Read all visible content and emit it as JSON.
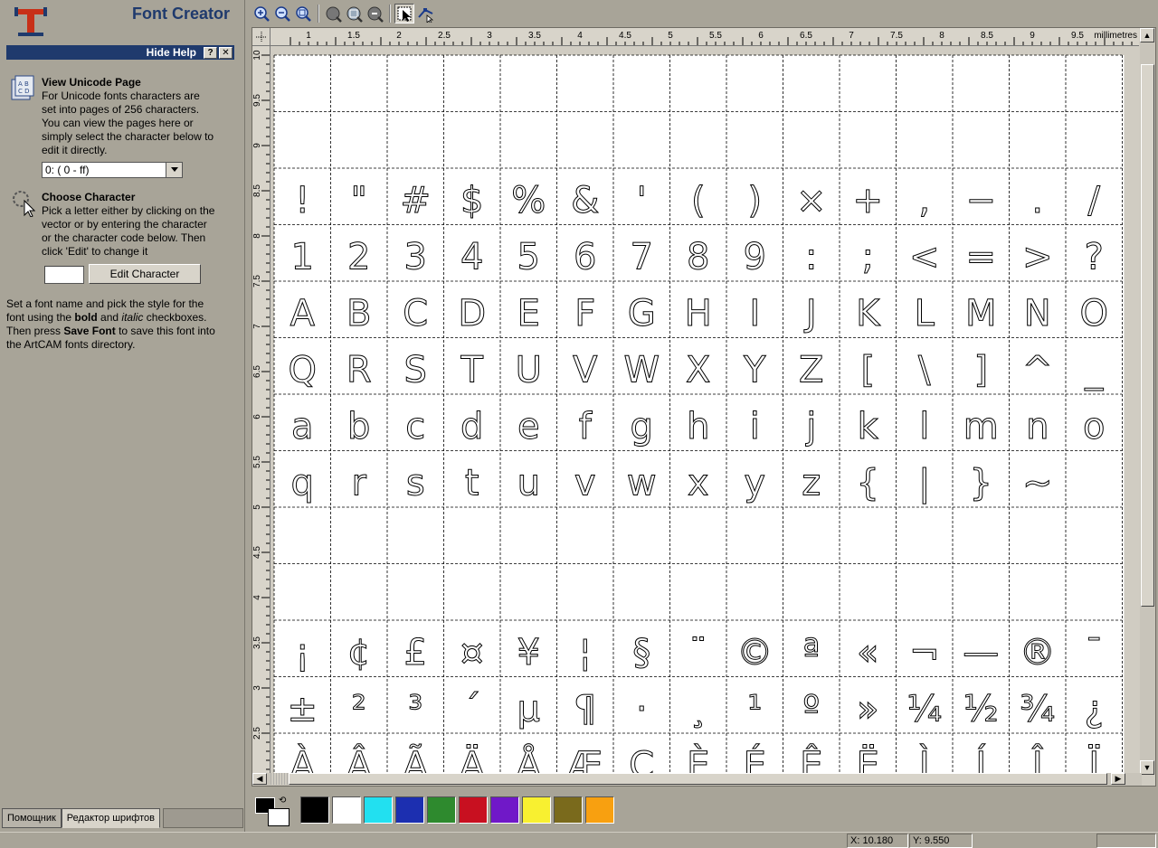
{
  "app": {
    "title": "Font Creator"
  },
  "help_bar": {
    "label": "Hide Help",
    "help_btn": "?",
    "close_btn": "✕"
  },
  "unicode_section": {
    "title": "View Unicode Page",
    "lines": [
      "For Unicode fonts characters are",
      "set into pages of 256 characters.",
      "You can view the pages here or",
      "simply select the character below to",
      "edit it directly."
    ],
    "selected_page": "0: ( 0 - ff)"
  },
  "choose_section": {
    "title": "Choose Character",
    "lines": [
      "Pick a letter either by clicking on the",
      "vector or by entering the character",
      "or the character code below. Then",
      "click 'Edit' to change it"
    ],
    "char_value": "",
    "edit_btn": "Edit Character"
  },
  "font_help": {
    "l1": "Set a font name and pick the style for the",
    "l2a": "font using the ",
    "bold_word": "bold",
    "l2b": " and ",
    "italic_word": "italic",
    "l2c": " checkboxes.",
    "l3a": "Then press ",
    "save_word": "Save Font",
    "l3b": " to save this font into",
    "l4": "the ArtCAM fonts directory."
  },
  "tabs": [
    {
      "label": "Помощник",
      "active": false
    },
    {
      "label": "Редактор шрифтов",
      "active": true
    }
  ],
  "toolbar": {
    "buttons": [
      "zoom-in-icon",
      "zoom-out-icon",
      "zoom-fit-icon",
      "sep",
      "view-all-icon",
      "zoom-box-icon",
      "view-previous-icon",
      "sep",
      "select-icon",
      "node-edit-icon"
    ]
  },
  "ruler": {
    "units": "millimetres",
    "h_labels": [
      "1",
      "1.5",
      "2",
      "2.5",
      "3",
      "3.5",
      "4",
      "4.5",
      "5",
      "5.5",
      "6",
      "6.5",
      "7",
      "7.5",
      "8",
      "8.5",
      "9",
      "9.5"
    ],
    "v_labels": [
      "10",
      "9.5",
      "9",
      "8.5",
      "8",
      "7.5",
      "7",
      "6.5",
      "6",
      "5.5",
      "5",
      "4.5",
      "4",
      "3.5",
      "3",
      "2.5"
    ]
  },
  "glyph_rows": [
    [
      "",
      "",
      "",
      "",
      "",
      "",
      "",
      "",
      "",
      "",
      "",
      "",
      "",
      "",
      "",
      ""
    ],
    [
      "",
      "",
      "",
      "",
      "",
      "",
      "",
      "",
      "",
      "",
      "",
      "",
      "",
      "",
      "",
      ""
    ],
    [
      "!",
      "\"",
      "#",
      "$",
      "%",
      "&",
      "'",
      "(",
      ")",
      "×",
      "+",
      ",",
      "−",
      ".",
      "/",
      ""
    ],
    [
      "1",
      "2",
      "3",
      "4",
      "5",
      "6",
      "7",
      "8",
      "9",
      ":",
      ";",
      "<",
      "=",
      ">",
      "?",
      ""
    ],
    [
      "A",
      "B",
      "C",
      "D",
      "E",
      "F",
      "G",
      "H",
      "I",
      "J",
      "K",
      "L",
      "M",
      "N",
      "O",
      ""
    ],
    [
      "Q",
      "R",
      "S",
      "T",
      "U",
      "V",
      "W",
      "X",
      "Y",
      "Z",
      "[",
      "\\",
      "]",
      "^",
      "_",
      ""
    ],
    [
      "a",
      "b",
      "c",
      "d",
      "e",
      "f",
      "g",
      "h",
      "i",
      "j",
      "k",
      "l",
      "m",
      "n",
      "o",
      ""
    ],
    [
      "q",
      "r",
      "s",
      "t",
      "u",
      "v",
      "w",
      "x",
      "y",
      "z",
      "{",
      "|",
      "}",
      "~",
      "",
      ""
    ],
    [
      "",
      "",
      "",
      "",
      "",
      "",
      "",
      "",
      "",
      "",
      "",
      "",
      "",
      "",
      "",
      ""
    ],
    [
      "",
      "",
      "",
      "",
      "",
      "",
      "",
      "",
      "",
      "",
      "",
      "",
      "",
      "",
      "",
      ""
    ],
    [
      "¡",
      "¢",
      "£",
      "¤",
      "¥",
      "¦",
      "§",
      "¨",
      "©",
      "ª",
      "«",
      "¬",
      "—",
      "®",
      "¯",
      ""
    ],
    [
      "±",
      "²",
      "³",
      "´",
      "µ",
      "¶",
      "·",
      "¸",
      "¹",
      "º",
      "»",
      "¼",
      "½",
      "¾",
      "¿",
      ""
    ],
    [
      "À",
      "Â",
      "Ã",
      "Ä",
      "Å",
      "Æ",
      "Ç",
      "È",
      "É",
      "Ê",
      "Ë",
      "Ì",
      "Í",
      "Î",
      "Ï",
      ""
    ]
  ],
  "palette": {
    "swatches": [
      "#000000",
      "#ffffff",
      "#22e0f0",
      "#1c2fb0",
      "#2e8a2e",
      "#c81020",
      "#7018c8",
      "#f8f030",
      "#7a6a1c",
      "#f8a010"
    ]
  },
  "status": {
    "x": "X: 10.180",
    "y": "Y: 9.550"
  }
}
